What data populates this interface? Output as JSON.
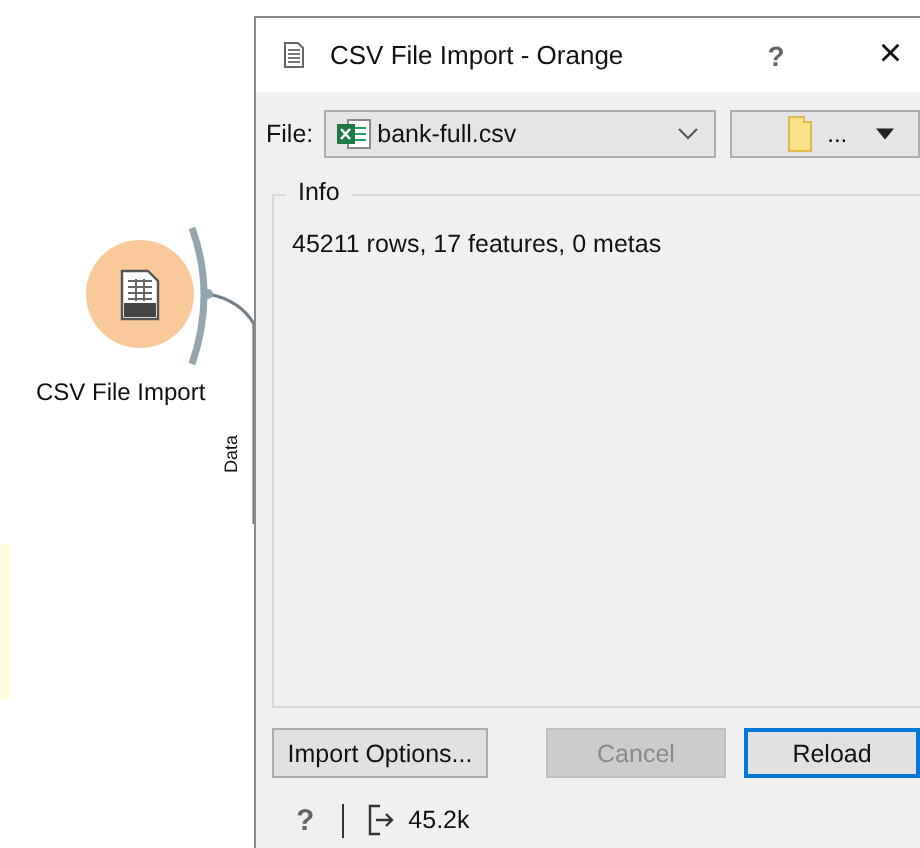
{
  "canvas": {
    "node": {
      "label": "CSV File Import"
    },
    "link": {
      "label": "Data"
    }
  },
  "dialog": {
    "title": "CSV File Import  - Orange",
    "title_buttons": [
      {
        "kind": "help",
        "label": "?"
      },
      {
        "kind": "close",
        "label": "×"
      }
    ],
    "file": {
      "label": "File:",
      "value": "bank-full.csv"
    },
    "browse_button": {
      "label": "..."
    },
    "info": {
      "title": "Info",
      "text": "45211 rows, 17 features, 0 metas"
    },
    "buttons": [
      {
        "label": "Import Options...",
        "disabled": false,
        "focused": false
      },
      {
        "label": "Cancel",
        "disabled": true,
        "focused": false
      },
      {
        "label": "Reload",
        "disabled": false,
        "focused": true
      }
    ],
    "status": {
      "help": "?",
      "output": "45.2k"
    }
  }
}
